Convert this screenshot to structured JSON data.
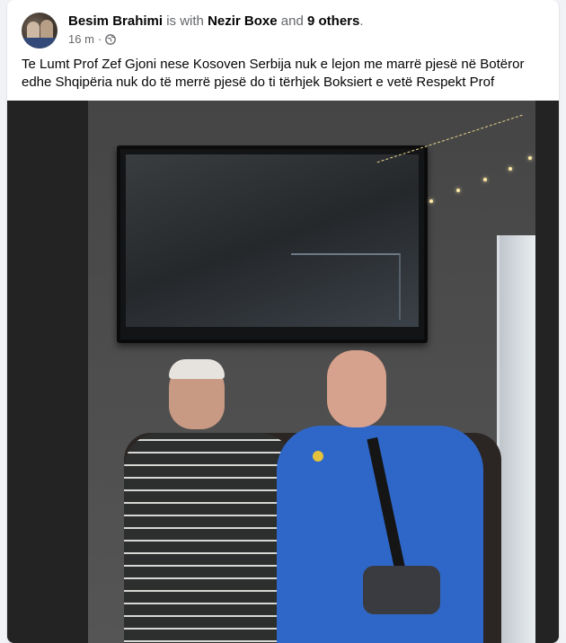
{
  "post": {
    "author": "Besim Brahimi",
    "with_text": "is with",
    "tagged_person": "Nezir Boxe",
    "and_text": "and",
    "others_label": "9 others",
    "period": ".",
    "time": "16 m",
    "separator": "·",
    "privacy_icon": "globe-icon",
    "text": "Te Lumt Prof Zef Gjoni nese Kosoven Serbija nuk e lejon me marrë pjesë në Botëror edhe Shqipëria nuk do të merrë pjesë do ti tërhjek Boksiert e vetë Respekt Prof"
  },
  "photo": {
    "description_icon": "photo"
  },
  "colors": {
    "page_bg": "#f0f2f5",
    "card_bg": "#ffffff",
    "primary_text": "#050505",
    "secondary_text": "#65676b"
  }
}
